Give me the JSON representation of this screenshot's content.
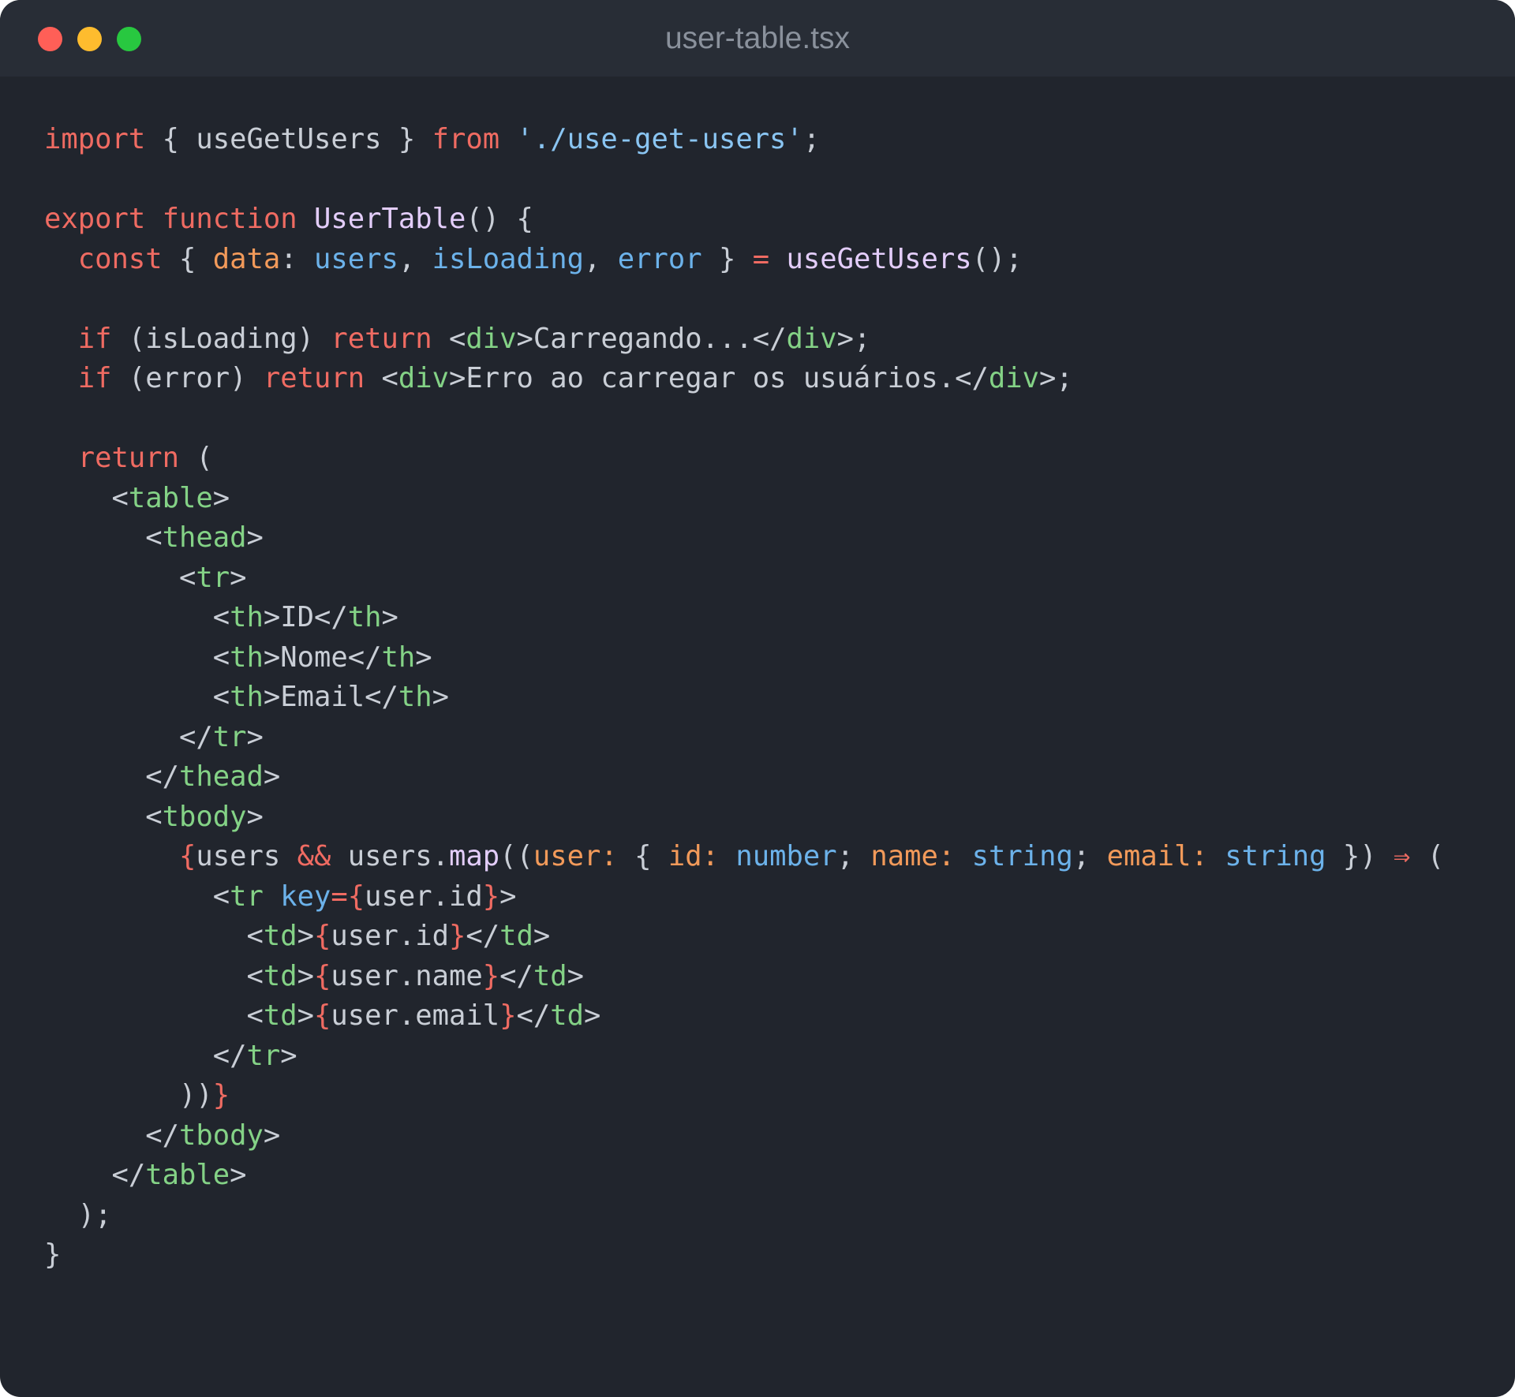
{
  "window": {
    "title": "user-table.tsx",
    "controls": [
      "close",
      "minimize",
      "maximize"
    ]
  },
  "code": {
    "language": "tsx",
    "lines": [
      [
        {
          "t": "import",
          "c": "kw"
        },
        {
          "t": " { useGetUsers } ",
          "c": "pl"
        },
        {
          "t": "from",
          "c": "kw"
        },
        {
          "t": " ",
          "c": "pl"
        },
        {
          "t": "'./use-get-users'",
          "c": "str"
        },
        {
          "t": ";",
          "c": "pl"
        }
      ],
      [],
      [
        {
          "t": "export",
          "c": "kw"
        },
        {
          "t": " ",
          "c": "pl"
        },
        {
          "t": "function",
          "c": "kw"
        },
        {
          "t": " ",
          "c": "pl"
        },
        {
          "t": "UserTable",
          "c": "fn"
        },
        {
          "t": "() {",
          "c": "pl"
        }
      ],
      [
        {
          "t": "  ",
          "c": "pl"
        },
        {
          "t": "const",
          "c": "kw"
        },
        {
          "t": " { ",
          "c": "pl"
        },
        {
          "t": "data",
          "c": "prop"
        },
        {
          "t": ": ",
          "c": "pl"
        },
        {
          "t": "users",
          "c": "var"
        },
        {
          "t": ", ",
          "c": "pl"
        },
        {
          "t": "isLoading",
          "c": "var"
        },
        {
          "t": ", ",
          "c": "pl"
        },
        {
          "t": "error",
          "c": "var"
        },
        {
          "t": " } ",
          "c": "pl"
        },
        {
          "t": "=",
          "c": "kw"
        },
        {
          "t": " ",
          "c": "pl"
        },
        {
          "t": "useGetUsers",
          "c": "fn"
        },
        {
          "t": "();",
          "c": "pl"
        }
      ],
      [],
      [
        {
          "t": "  ",
          "c": "pl"
        },
        {
          "t": "if",
          "c": "kw"
        },
        {
          "t": " (isLoading) ",
          "c": "pl"
        },
        {
          "t": "return",
          "c": "kw"
        },
        {
          "t": " <",
          "c": "pl"
        },
        {
          "t": "div",
          "c": "tag"
        },
        {
          "t": ">Carregando...</",
          "c": "pl"
        },
        {
          "t": "div",
          "c": "tag"
        },
        {
          "t": ">;",
          "c": "pl"
        }
      ],
      [
        {
          "t": "  ",
          "c": "pl"
        },
        {
          "t": "if",
          "c": "kw"
        },
        {
          "t": " (error) ",
          "c": "pl"
        },
        {
          "t": "return",
          "c": "kw"
        },
        {
          "t": " <",
          "c": "pl"
        },
        {
          "t": "div",
          "c": "tag"
        },
        {
          "t": ">Erro ao carregar os usuários.</",
          "c": "pl"
        },
        {
          "t": "div",
          "c": "tag"
        },
        {
          "t": ">;",
          "c": "pl"
        }
      ],
      [],
      [
        {
          "t": "  ",
          "c": "pl"
        },
        {
          "t": "return",
          "c": "kw"
        },
        {
          "t": " (",
          "c": "pl"
        }
      ],
      [
        {
          "t": "    <",
          "c": "pl"
        },
        {
          "t": "table",
          "c": "tag"
        },
        {
          "t": ">",
          "c": "pl"
        }
      ],
      [
        {
          "t": "      <",
          "c": "pl"
        },
        {
          "t": "thead",
          "c": "tag"
        },
        {
          "t": ">",
          "c": "pl"
        }
      ],
      [
        {
          "t": "        <",
          "c": "pl"
        },
        {
          "t": "tr",
          "c": "tag"
        },
        {
          "t": ">",
          "c": "pl"
        }
      ],
      [
        {
          "t": "          <",
          "c": "pl"
        },
        {
          "t": "th",
          "c": "tag"
        },
        {
          "t": ">ID</",
          "c": "pl"
        },
        {
          "t": "th",
          "c": "tag"
        },
        {
          "t": ">",
          "c": "pl"
        }
      ],
      [
        {
          "t": "          <",
          "c": "pl"
        },
        {
          "t": "th",
          "c": "tag"
        },
        {
          "t": ">Nome</",
          "c": "pl"
        },
        {
          "t": "th",
          "c": "tag"
        },
        {
          "t": ">",
          "c": "pl"
        }
      ],
      [
        {
          "t": "          <",
          "c": "pl"
        },
        {
          "t": "th",
          "c": "tag"
        },
        {
          "t": ">Email</",
          "c": "pl"
        },
        {
          "t": "th",
          "c": "tag"
        },
        {
          "t": ">",
          "c": "pl"
        }
      ],
      [
        {
          "t": "        </",
          "c": "pl"
        },
        {
          "t": "tr",
          "c": "tag"
        },
        {
          "t": ">",
          "c": "pl"
        }
      ],
      [
        {
          "t": "      </",
          "c": "pl"
        },
        {
          "t": "thead",
          "c": "tag"
        },
        {
          "t": ">",
          "c": "pl"
        }
      ],
      [
        {
          "t": "      <",
          "c": "pl"
        },
        {
          "t": "tbody",
          "c": "tag"
        },
        {
          "t": ">",
          "c": "pl"
        }
      ],
      [
        {
          "t": "        ",
          "c": "pl"
        },
        {
          "t": "{",
          "c": "brace"
        },
        {
          "t": "users ",
          "c": "pl"
        },
        {
          "t": "&&",
          "c": "kw"
        },
        {
          "t": " users.",
          "c": "pl"
        },
        {
          "t": "map",
          "c": "fn"
        },
        {
          "t": "((",
          "c": "pl"
        },
        {
          "t": "user:",
          "c": "prop"
        },
        {
          "t": " { ",
          "c": "pl"
        },
        {
          "t": "id:",
          "c": "prop"
        },
        {
          "t": " ",
          "c": "pl"
        },
        {
          "t": "number",
          "c": "var"
        },
        {
          "t": "; ",
          "c": "pl"
        },
        {
          "t": "name:",
          "c": "prop"
        },
        {
          "t": " ",
          "c": "pl"
        },
        {
          "t": "string",
          "c": "var"
        },
        {
          "t": "; ",
          "c": "pl"
        },
        {
          "t": "email:",
          "c": "prop"
        },
        {
          "t": " ",
          "c": "pl"
        },
        {
          "t": "string",
          "c": "var"
        },
        {
          "t": " }) ",
          "c": "pl"
        },
        {
          "t": "⇒",
          "c": "kw"
        },
        {
          "t": " (",
          "c": "pl"
        }
      ],
      [
        {
          "t": "          <",
          "c": "pl"
        },
        {
          "t": "tr",
          "c": "tag"
        },
        {
          "t": " ",
          "c": "pl"
        },
        {
          "t": "key",
          "c": "var"
        },
        {
          "t": "=",
          "c": "kw"
        },
        {
          "t": "{",
          "c": "brace"
        },
        {
          "t": "user.id",
          "c": "pl"
        },
        {
          "t": "}",
          "c": "brace"
        },
        {
          "t": ">",
          "c": "pl"
        }
      ],
      [
        {
          "t": "            <",
          "c": "pl"
        },
        {
          "t": "td",
          "c": "tag"
        },
        {
          "t": ">",
          "c": "pl"
        },
        {
          "t": "{",
          "c": "brace"
        },
        {
          "t": "user.id",
          "c": "pl"
        },
        {
          "t": "}",
          "c": "brace"
        },
        {
          "t": "</",
          "c": "pl"
        },
        {
          "t": "td",
          "c": "tag"
        },
        {
          "t": ">",
          "c": "pl"
        }
      ],
      [
        {
          "t": "            <",
          "c": "pl"
        },
        {
          "t": "td",
          "c": "tag"
        },
        {
          "t": ">",
          "c": "pl"
        },
        {
          "t": "{",
          "c": "brace"
        },
        {
          "t": "user.name",
          "c": "pl"
        },
        {
          "t": "}",
          "c": "brace"
        },
        {
          "t": "</",
          "c": "pl"
        },
        {
          "t": "td",
          "c": "tag"
        },
        {
          "t": ">",
          "c": "pl"
        }
      ],
      [
        {
          "t": "            <",
          "c": "pl"
        },
        {
          "t": "td",
          "c": "tag"
        },
        {
          "t": ">",
          "c": "pl"
        },
        {
          "t": "{",
          "c": "brace"
        },
        {
          "t": "user.email",
          "c": "pl"
        },
        {
          "t": "}",
          "c": "brace"
        },
        {
          "t": "</",
          "c": "pl"
        },
        {
          "t": "td",
          "c": "tag"
        },
        {
          "t": ">",
          "c": "pl"
        }
      ],
      [
        {
          "t": "          </",
          "c": "pl"
        },
        {
          "t": "tr",
          "c": "tag"
        },
        {
          "t": ">",
          "c": "pl"
        }
      ],
      [
        {
          "t": "        ))",
          "c": "pl"
        },
        {
          "t": "}",
          "c": "brace"
        }
      ],
      [
        {
          "t": "      </",
          "c": "pl"
        },
        {
          "t": "tbody",
          "c": "tag"
        },
        {
          "t": ">",
          "c": "pl"
        }
      ],
      [
        {
          "t": "    </",
          "c": "pl"
        },
        {
          "t": "table",
          "c": "tag"
        },
        {
          "t": ">",
          "c": "pl"
        }
      ],
      [
        {
          "t": "  );",
          "c": "pl"
        }
      ],
      [
        {
          "t": "}",
          "c": "pl"
        }
      ]
    ]
  },
  "colors": {
    "window_bg": "#21252d",
    "titlebar_bg": "#282d36",
    "keyword": "#ef6b62",
    "string": "#8ac5f2",
    "function": "#e3cdfa",
    "property": "#f29a5a",
    "variable": "#6cb2ea",
    "tag": "#84d286",
    "plain": "#c9ced6"
  }
}
